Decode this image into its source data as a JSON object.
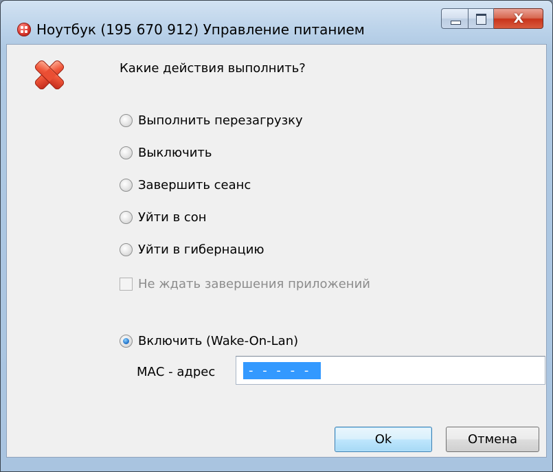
{
  "window": {
    "title": "Ноутбук (195 670 912) Управление питанием",
    "close_glyph": "X"
  },
  "icons": {
    "app": "app-logo-icon",
    "warning": "red-x-icon",
    "minimize": "minimize-icon",
    "maximize": "maximize-icon",
    "close": "close-icon"
  },
  "dialog": {
    "question": "Какие действия выполнить?",
    "options": [
      {
        "label": "Выполнить перезагрузку",
        "checked": false
      },
      {
        "label": "Выключить",
        "checked": false
      },
      {
        "label": "Завершить сеанс",
        "checked": false
      },
      {
        "label": "Уйти в сон",
        "checked": false
      },
      {
        "label": "Уйти в гибернацию",
        "checked": false
      }
    ],
    "no_wait_checkbox": {
      "label": "Не ждать завершения приложений",
      "checked": false,
      "enabled": false
    },
    "wake_on_lan": {
      "label": "Включить (Wake-On-Lan)",
      "checked": true
    },
    "mac": {
      "label": "МАС - адрес",
      "value": "- - - - -"
    },
    "buttons": {
      "ok": "Ok",
      "cancel": "Отмена"
    }
  },
  "colors": {
    "selection": "#3399ff",
    "close_button": "#c9331b",
    "radio_dot": "#1a6bc4"
  }
}
